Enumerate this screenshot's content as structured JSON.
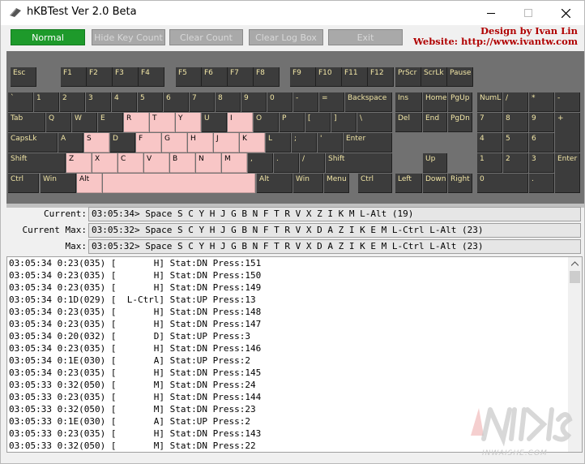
{
  "window": {
    "title": "hKBTest Ver 2.0 Beta"
  },
  "toolbar": {
    "normal": "Normal",
    "hide_key_count": "Hide Key Count",
    "clear_count": "Clear Count",
    "clear_log_box": "Clear Log Box",
    "exit": "Exit",
    "credit_line1": "Design by Ivan Lin",
    "credit_line2": "Website: http://www.ivantw.com"
  },
  "colors": {
    "active_button": "#1e9a2b",
    "key": "#3c3c3c",
    "key_text": "#f2e6a6",
    "key_pressed": "#f8c6c6",
    "credit": "#b00000",
    "keyboard_bg": "#717171"
  },
  "keys": [
    {
      "label": "Esc",
      "pressed": false
    },
    {
      "label": "F1",
      "pressed": false
    },
    {
      "label": "F2",
      "pressed": false
    },
    {
      "label": "F3",
      "pressed": false
    },
    {
      "label": "F4",
      "pressed": false
    },
    {
      "label": "F5",
      "pressed": false
    },
    {
      "label": "F6",
      "pressed": false
    },
    {
      "label": "F7",
      "pressed": false
    },
    {
      "label": "F8",
      "pressed": false
    },
    {
      "label": "F9",
      "pressed": false
    },
    {
      "label": "F10",
      "pressed": false
    },
    {
      "label": "F11",
      "pressed": false
    },
    {
      "label": "F12",
      "pressed": false
    },
    {
      "label": "PrScr",
      "pressed": false
    },
    {
      "label": "ScrLk",
      "pressed": false
    },
    {
      "label": "Pause",
      "pressed": false
    },
    {
      "label": "`",
      "pressed": false
    },
    {
      "label": "1",
      "pressed": false
    },
    {
      "label": "2",
      "pressed": false
    },
    {
      "label": "3",
      "pressed": false
    },
    {
      "label": "4",
      "pressed": false
    },
    {
      "label": "5",
      "pressed": false
    },
    {
      "label": "6",
      "pressed": false
    },
    {
      "label": "7",
      "pressed": false
    },
    {
      "label": "8",
      "pressed": false
    },
    {
      "label": "9",
      "pressed": false
    },
    {
      "label": "0",
      "pressed": false
    },
    {
      "label": "-",
      "pressed": false
    },
    {
      "label": "=",
      "pressed": false
    },
    {
      "label": "Backspace",
      "pressed": false
    },
    {
      "label": "Ins",
      "pressed": false
    },
    {
      "label": "Home",
      "pressed": false
    },
    {
      "label": "PgUp",
      "pressed": false
    },
    {
      "label": "NumLk",
      "pressed": false
    },
    {
      "label": "/",
      "pressed": false
    },
    {
      "label": "*",
      "pressed": false
    },
    {
      "label": "-",
      "pressed": false
    },
    {
      "label": "Tab",
      "pressed": false
    },
    {
      "label": "Q",
      "pressed": false
    },
    {
      "label": "W",
      "pressed": false
    },
    {
      "label": "E",
      "pressed": false
    },
    {
      "label": "R",
      "pressed": true
    },
    {
      "label": "T",
      "pressed": true
    },
    {
      "label": "Y",
      "pressed": true
    },
    {
      "label": "U",
      "pressed": false
    },
    {
      "label": "I",
      "pressed": true
    },
    {
      "label": "O",
      "pressed": false
    },
    {
      "label": "P",
      "pressed": false
    },
    {
      "label": "[",
      "pressed": false
    },
    {
      "label": "]",
      "pressed": false
    },
    {
      "label": "\\",
      "pressed": false
    },
    {
      "label": "Del",
      "pressed": false
    },
    {
      "label": "End",
      "pressed": false
    },
    {
      "label": "PgDn",
      "pressed": false
    },
    {
      "label": "7",
      "pressed": false
    },
    {
      "label": "8",
      "pressed": false
    },
    {
      "label": "9",
      "pressed": false
    },
    {
      "label": "+",
      "pressed": false
    },
    {
      "label": "CapsLk",
      "pressed": false
    },
    {
      "label": "A",
      "pressed": false
    },
    {
      "label": "S",
      "pressed": true
    },
    {
      "label": "D",
      "pressed": false
    },
    {
      "label": "F",
      "pressed": true
    },
    {
      "label": "G",
      "pressed": true
    },
    {
      "label": "H",
      "pressed": true
    },
    {
      "label": "J",
      "pressed": true
    },
    {
      "label": "K",
      "pressed": true
    },
    {
      "label": "L",
      "pressed": false
    },
    {
      "label": ";",
      "pressed": false
    },
    {
      "label": "'",
      "pressed": false
    },
    {
      "label": "Enter",
      "pressed": false
    },
    {
      "label": "4",
      "pressed": false
    },
    {
      "label": "5",
      "pressed": false
    },
    {
      "label": "6",
      "pressed": false
    },
    {
      "label": "Shift",
      "pressed": false
    },
    {
      "label": "Z",
      "pressed": true
    },
    {
      "label": "X",
      "pressed": true
    },
    {
      "label": "C",
      "pressed": true
    },
    {
      "label": "V",
      "pressed": true
    },
    {
      "label": "B",
      "pressed": true
    },
    {
      "label": "N",
      "pressed": true
    },
    {
      "label": "M",
      "pressed": true
    },
    {
      "label": ",",
      "pressed": false
    },
    {
      "label": ".",
      "pressed": false
    },
    {
      "label": "/",
      "pressed": false
    },
    {
      "label": "Shift",
      "pressed": false
    },
    {
      "label": "Up",
      "pressed": false
    },
    {
      "label": "1",
      "pressed": false
    },
    {
      "label": "2",
      "pressed": false
    },
    {
      "label": "3",
      "pressed": false
    },
    {
      "label": "Enter",
      "pressed": false
    },
    {
      "label": "Ctrl",
      "pressed": false
    },
    {
      "label": "Win",
      "pressed": false
    },
    {
      "label": "Alt",
      "pressed": true
    },
    {
      "label": "",
      "pressed": true
    },
    {
      "label": "Alt",
      "pressed": false
    },
    {
      "label": "Win",
      "pressed": false
    },
    {
      "label": "Menu",
      "pressed": false
    },
    {
      "label": "Ctrl",
      "pressed": false
    },
    {
      "label": "Left",
      "pressed": false
    },
    {
      "label": "Down",
      "pressed": false
    },
    {
      "label": "Right",
      "pressed": false
    },
    {
      "label": "0",
      "pressed": false
    },
    {
      "label": ".",
      "pressed": false
    }
  ],
  "status": {
    "current_label": "Current:",
    "current_value": "03:05:34> Space S C Y H J G B N F T R V X Z I K M L-Alt (19)",
    "current_max_label": "Current Max:",
    "current_max_value": "03:05:32> Space S C Y H J G B N F T R V X D A Z I K E M L-Ctrl L-Alt (23)",
    "max_label": "Max:",
    "max_value": "03:05:32> Space S C Y H J G B N F T R V X D A Z I K E M L-Ctrl L-Alt (23)"
  },
  "log": [
    "03:05:34 0:23(035) [       H] Stat:DN Press:151",
    "03:05:34 0:23(035) [       H] Stat:DN Press:150",
    "03:05:34 0:23(035) [       H] Stat:DN Press:149",
    "03:05:34 0:1D(029) [  L-Ctrl] Stat:UP Press:13",
    "03:05:34 0:23(035) [       H] Stat:DN Press:148",
    "03:05:34 0:23(035) [       H] Stat:DN Press:147",
    "03:05:34 0:20(032) [       D] Stat:UP Press:3",
    "03:05:34 0:23(035) [       H] Stat:DN Press:146",
    "03:05:34 0:1E(030) [       A] Stat:UP Press:2",
    "03:05:34 0:23(035) [       H] Stat:DN Press:145",
    "03:05:33 0:32(050) [       M] Stat:DN Press:24",
    "03:05:33 0:23(035) [       H] Stat:DN Press:144",
    "03:05:33 0:32(050) [       M] Stat:DN Press:23",
    "03:05:33 0:1E(030) [       A] Stat:UP Press:2",
    "03:05:33 0:23(035) [       H] Stat:DN Press:143",
    "03:05:33 0:32(050) [       M] Stat:DN Press:22"
  ],
  "watermark": {
    "text": "INWAISHE.COM"
  }
}
